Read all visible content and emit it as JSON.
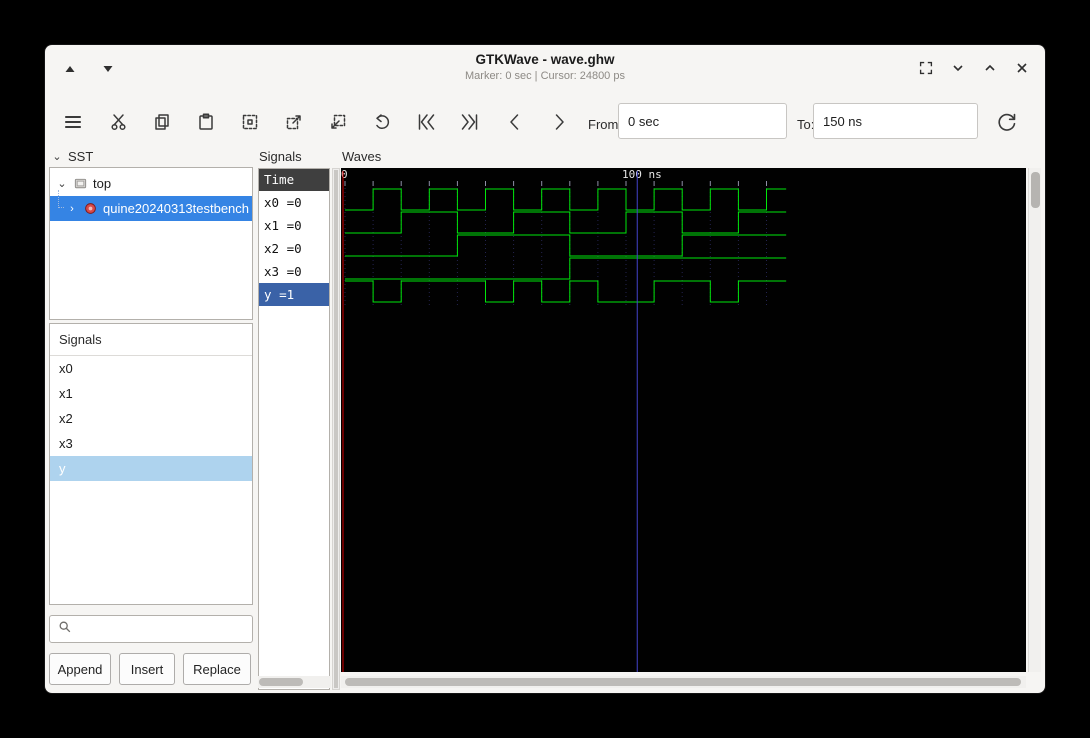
{
  "window": {
    "title": "GTKWave - wave.ghw",
    "subtitle": "Marker: 0 sec | Cursor: 24800 ps"
  },
  "toolbar": {
    "from_label": "From:",
    "from_value": "0 sec",
    "to_label": "To:",
    "to_value": "150 ns"
  },
  "sst": {
    "header": "SST",
    "nodes": [
      {
        "label": "top"
      },
      {
        "label": "quine20240313testbench"
      }
    ]
  },
  "signals_list": {
    "header": "Signals",
    "items": [
      "x0",
      "x1",
      "x2",
      "x3",
      "y"
    ],
    "buttons": {
      "append": "Append",
      "insert": "Insert",
      "replace": "Replace"
    }
  },
  "middle": {
    "frame_label": "Signals",
    "time_header": "Time",
    "rows": [
      {
        "name": "x0",
        "value": "=0"
      },
      {
        "name": "x1",
        "value": "=0"
      },
      {
        "name": "x2",
        "value": "=0"
      },
      {
        "name": "x3",
        "value": "=0"
      },
      {
        "name": "y",
        "value": "=1"
      }
    ]
  },
  "waves": {
    "frame_label": "Waves"
  },
  "chart_data": {
    "type": "line",
    "subtype": "digital-timing-diagram",
    "title": "GHW simulation waveforms",
    "x_unit": "ns",
    "x_range": [
      0,
      157
    ],
    "step_ns": 10,
    "grid_interval_ns": 10,
    "timeline_labels": [
      {
        "t": 0,
        "text": "0"
      },
      {
        "t": 100,
        "text": "100 ns"
      }
    ],
    "marker_ns": 0,
    "cursor_ns": 104,
    "trace_color": "#00e80a",
    "marker_color": "#d40000",
    "cursor_color": "#4343cc",
    "signals": [
      {
        "name": "x0",
        "values": [
          0,
          1,
          0,
          1,
          0,
          1,
          0,
          1,
          0,
          1,
          0,
          1,
          0,
          1,
          0,
          1
        ]
      },
      {
        "name": "x1",
        "values": [
          0,
          0,
          1,
          1,
          0,
          0,
          1,
          1,
          0,
          0,
          1,
          1,
          0,
          0,
          1,
          1
        ]
      },
      {
        "name": "x2",
        "values": [
          0,
          0,
          0,
          0,
          1,
          1,
          1,
          1,
          0,
          0,
          0,
          0,
          1,
          1,
          1,
          1
        ]
      },
      {
        "name": "x3",
        "values": [
          0,
          0,
          0,
          0,
          0,
          0,
          0,
          0,
          1,
          1,
          1,
          1,
          1,
          1,
          1,
          1
        ]
      },
      {
        "name": "y",
        "values": [
          1,
          0,
          1,
          1,
          1,
          0,
          1,
          0,
          1,
          0,
          0,
          1,
          1,
          0,
          1,
          1
        ]
      }
    ]
  }
}
